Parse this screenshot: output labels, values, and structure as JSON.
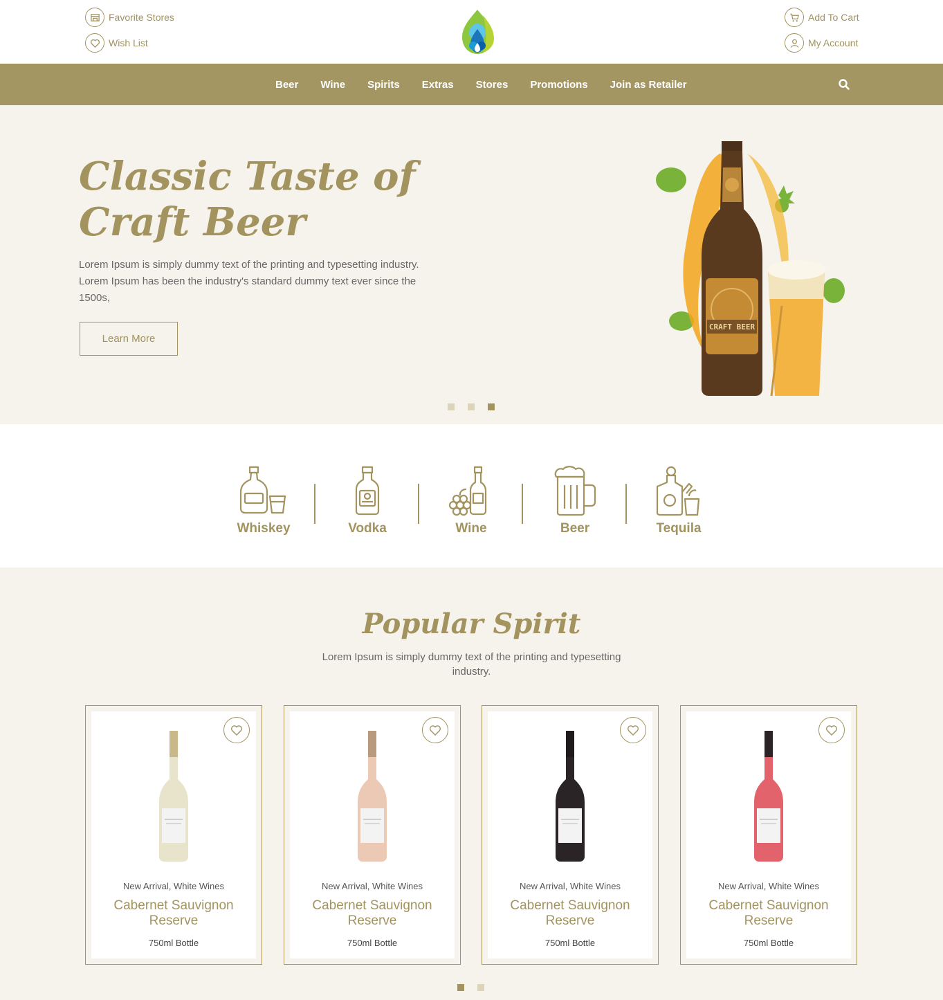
{
  "header": {
    "favorite_stores": "Favorite Stores",
    "wish_list": "Wish List",
    "add_to_cart": "Add To Cart",
    "my_account": "My Account"
  },
  "nav": {
    "items": [
      {
        "label": "Beer"
      },
      {
        "label": "Wine"
      },
      {
        "label": "Spirits"
      },
      {
        "label": "Extras"
      },
      {
        "label": "Stores"
      },
      {
        "label": "Promotions"
      },
      {
        "label": "Join as Retailer"
      }
    ]
  },
  "hero": {
    "title_line1": "Classic Taste of",
    "title_line2": "Craft Beer",
    "text": "Lorem Ipsum is simply dummy text of the printing and typesetting industry. Lorem Ipsum has been the industry's standard dummy text ever since the 1500s,",
    "button": "Learn More",
    "slides": 3,
    "active_slide": 3,
    "label_text": "CRAFT BEER"
  },
  "categories": [
    {
      "label": "Whiskey",
      "icon": "whiskey-icon"
    },
    {
      "label": "Vodka",
      "icon": "vodka-icon"
    },
    {
      "label": "Wine",
      "icon": "wine-icon"
    },
    {
      "label": "Beer",
      "icon": "beer-icon"
    },
    {
      "label": "Tequila",
      "icon": "tequila-icon"
    }
  ],
  "popular": {
    "title": "Popular Spirit",
    "subtitle": "Lorem Ipsum is simply dummy text of the printing and typesetting industry.",
    "products": [
      {
        "category": "New Arrival, White Wines",
        "name": "Cabernet Sauvignon Reserve",
        "size": "750ml Bottle",
        "wine_color": "#e8e4cc",
        "cap_color": "#c9b98a"
      },
      {
        "category": "New Arrival, White Wines",
        "name": "Cabernet Sauvignon Reserve",
        "size": "750ml Bottle",
        "wine_color": "#ecc9b4",
        "cap_color": "#b89a7c"
      },
      {
        "category": "New Arrival, White Wines",
        "name": "Cabernet Sauvignon Reserve",
        "size": "750ml Bottle",
        "wine_color": "#2a2426",
        "cap_color": "#1e1a1c"
      },
      {
        "category": "New Arrival, White Wines",
        "name": "Cabernet Sauvignon Reserve",
        "size": "750ml Bottle",
        "wine_color": "#e2636b",
        "cap_color": "#2a2426"
      }
    ],
    "pages": 2,
    "active_page": 1
  },
  "colors": {
    "accent": "#a2935f",
    "nav_bg": "#a49663",
    "section_bg": "#f6f3ec"
  }
}
